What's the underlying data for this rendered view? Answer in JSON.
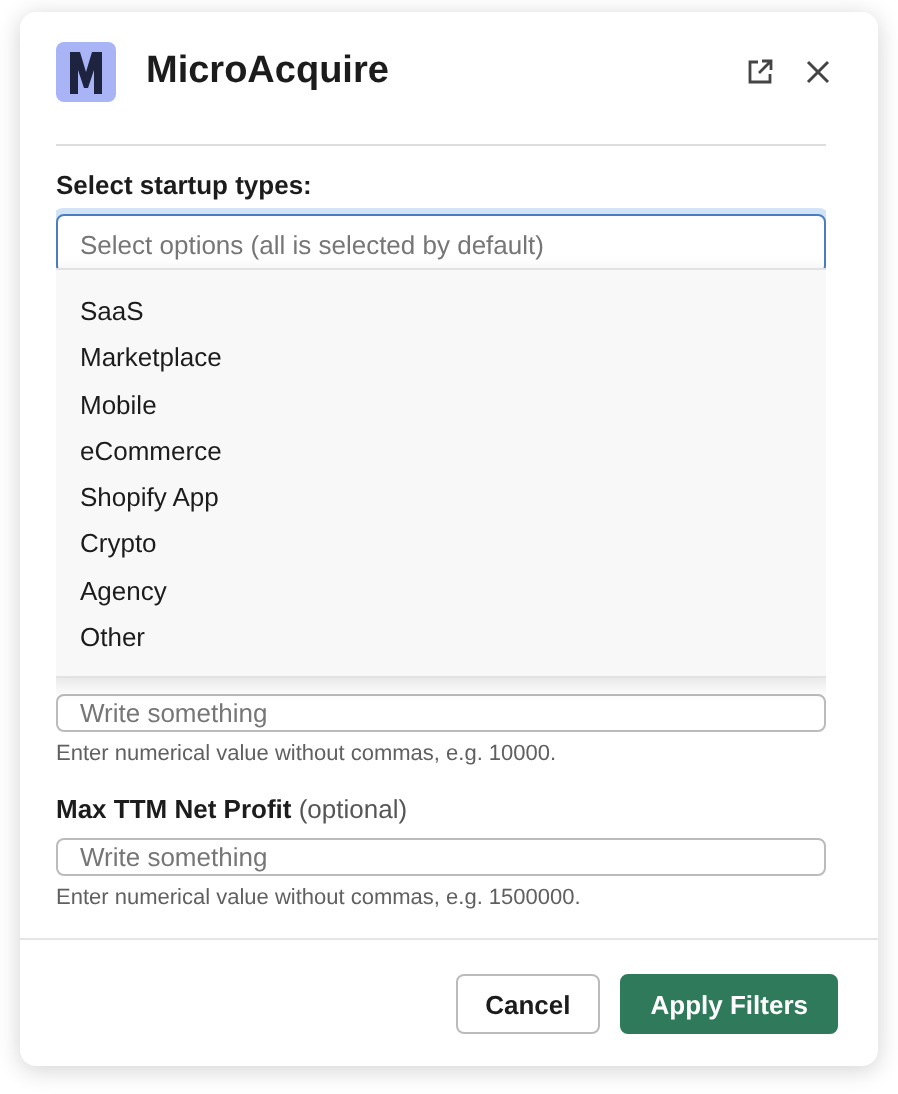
{
  "app": {
    "title": "MicroAcquire"
  },
  "startup_types": {
    "label": "Select startup types:",
    "placeholder": "Select options (all is selected by default)",
    "focused": true,
    "menu_open": true,
    "options": [
      {
        "label": "SaaS"
      },
      {
        "label": "Marketplace"
      },
      {
        "label": "Mobile"
      },
      {
        "label": "eCommerce"
      },
      {
        "label": "Shopify App"
      },
      {
        "label": "Crypto"
      },
      {
        "label": "Agency"
      },
      {
        "label": "Other"
      }
    ]
  },
  "fields": [
    {
      "placeholder": "Write something",
      "hint": "Enter numerical value without commas, e.g. 10000."
    },
    {
      "label": "Max TTM Net Profit",
      "note": "(optional)",
      "placeholder": "Write something",
      "hint": "Enter numerical value without commas, e.g. 1500000."
    }
  ],
  "buttons": [
    {
      "label": "Cancel",
      "kind": "secondary"
    },
    {
      "label": "Apply Filters",
      "kind": "primary"
    }
  ]
}
